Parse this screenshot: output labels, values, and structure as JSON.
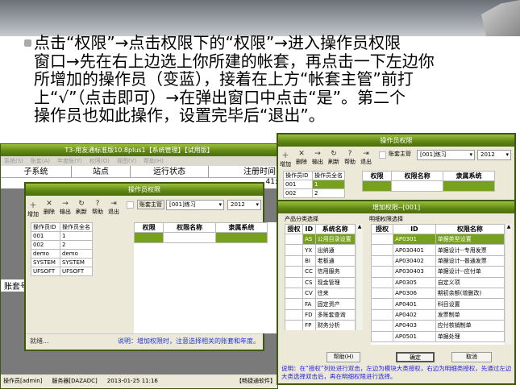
{
  "slide": {
    "lines": [
      "点击“权限”→点击权限下的“权限”→进入操作员权限",
      "窗口→先在右上边选上你所建的帐套，再点击一下左边你",
      "所增加的操作员（变蓝），接着在上方“帐套主管”前打",
      "上“√”（点击即可）→在弹出窗口中点击“是”。第二个",
      "操作员也如此操作，设置完毕后“退出”。"
    ]
  },
  "main_window": {
    "title": "T3-用友通标准版10.8plus1【系统管理】【试用版】",
    "menu": [
      "系统(S)",
      "账套(A)",
      "年度账(Y)",
      "权限(O)",
      "视图(V)",
      "帮助(H)"
    ],
    "columns": [
      "子系统",
      "站点",
      "运行状态",
      "注册时间"
    ],
    "row_fragment": "41:",
    "side_label": "账套号",
    "status": {
      "operator": "操作员[admin]",
      "server": "服务器[DAZADC]",
      "datetime": "2013-01-25 11:16",
      "brand": "【畅捷通软件】"
    }
  },
  "perm_dialog": {
    "title": "操作员权限",
    "toolbar": [
      "增加",
      "删除",
      "输出",
      "刷新",
      "帮助",
      "退出"
    ],
    "master_label": "账套主管",
    "account": "[001]练习",
    "year": "2012",
    "op_columns": [
      "操作员ID",
      "操作员全名"
    ],
    "operators": [
      [
        "001",
        "1"
      ],
      [
        "002",
        "2"
      ],
      [
        "demo",
        "demo"
      ],
      [
        "SYSTEM",
        "SYSTEM"
      ],
      [
        "UFSOFT",
        "UFSOFT"
      ]
    ],
    "perm_columns": [
      "权限",
      "权限名称",
      "隶属系统"
    ],
    "status_left": "就绪...",
    "note": "说明：增加权限时，注意选择相关的账套和年度。"
  },
  "add_dialog": {
    "title": "增加权限--[001]",
    "left_group": "产品分类选择",
    "right_group": "明细权限选择",
    "left_columns": [
      "授权",
      "ID",
      "系统名称"
    ],
    "modules": [
      [
        "AS",
        "公用目录设置"
      ],
      [
        "YX",
        "出纳通"
      ],
      [
        "BI",
        "老板通"
      ],
      [
        "CC",
        "信用服务"
      ],
      [
        "CS",
        "现金管理"
      ],
      [
        "CV",
        "往来"
      ],
      [
        "FA",
        "固定资产"
      ],
      [
        "FD",
        "多账套查询"
      ],
      [
        "FP",
        "财务分析"
      ]
    ],
    "right_columns": [
      "授权",
      "ID",
      "权限名称"
    ],
    "details": [
      [
        "AP0301",
        "单据类型设置"
      ],
      [
        "AP030401",
        "单据设计--专用发票"
      ],
      [
        "AP030402",
        "单据设计--普通发票"
      ],
      [
        "AP030403",
        "单据设计--应付单"
      ],
      [
        "AP0305",
        "自定义项"
      ],
      [
        "AP0306",
        "期初余额(增删改)"
      ],
      [
        "AP0401",
        "科目设置"
      ],
      [
        "AP0402",
        "发票制单"
      ],
      [
        "AP0403",
        "应付核销制单"
      ],
      [
        "AP0501",
        "单据处理"
      ]
    ],
    "help": "帮助(H)",
    "ok": "确定",
    "cancel": "取消",
    "note": "说明：在“授权”列处进行双击，左边为模块大类授权，右边为明细类授权，先通过左边大类选择双击后，再在明细权限进行选择。"
  },
  "colors": {
    "title_green": "#5d8413",
    "select_green": "#77a11c",
    "note_blue": "#2222dd"
  }
}
